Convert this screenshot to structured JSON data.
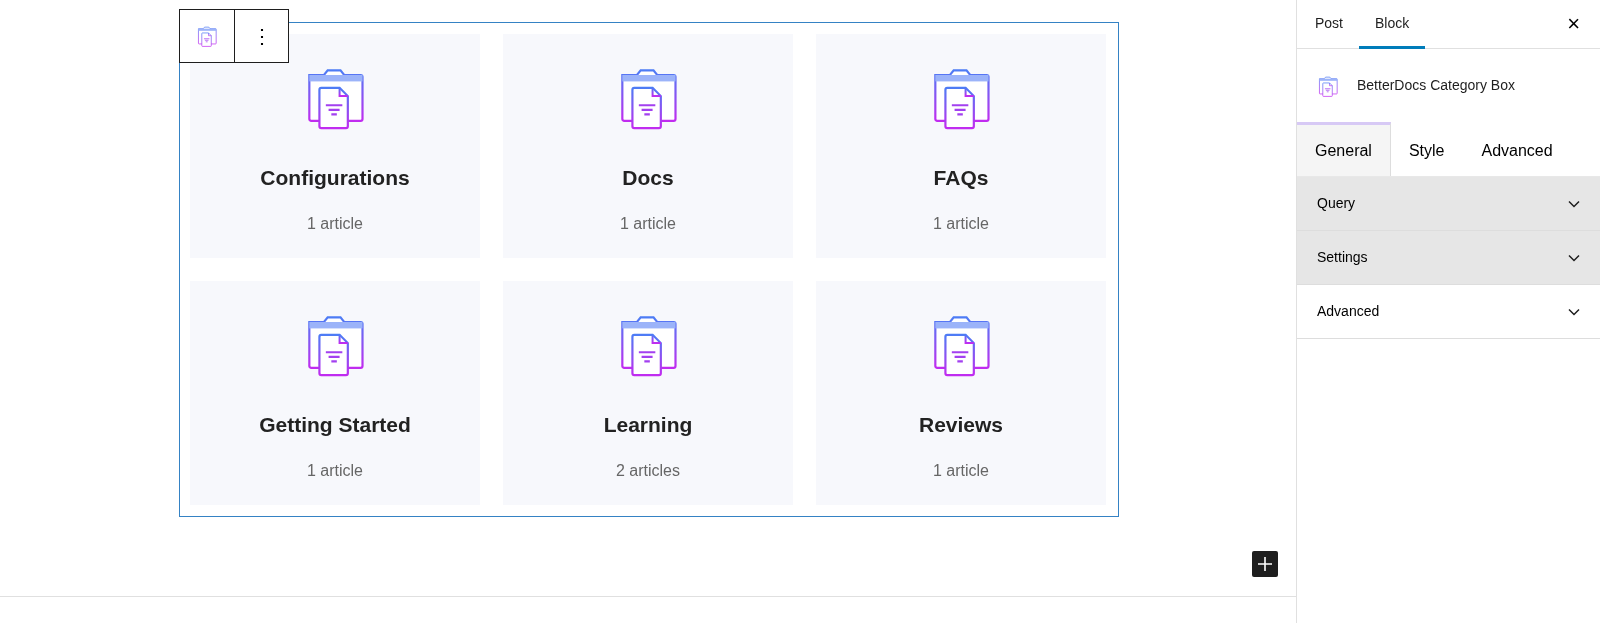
{
  "block_toolbar": {
    "more": "⋮"
  },
  "categories": [
    {
      "title": "Configurations",
      "count": "1 article"
    },
    {
      "title": "Docs",
      "count": "1 article"
    },
    {
      "title": "FAQs",
      "count": "1 article"
    },
    {
      "title": "Getting Started",
      "count": "1 article"
    },
    {
      "title": "Learning",
      "count": "2 articles"
    },
    {
      "title": "Reviews",
      "count": "1 article"
    }
  ],
  "sidebar": {
    "tabs": [
      {
        "label": "Post",
        "selected": false
      },
      {
        "label": "Block",
        "selected": true
      }
    ],
    "close": "×",
    "block_name": "BetterDocs Category Box",
    "inner_tabs": [
      {
        "label": "General",
        "selected": true
      },
      {
        "label": "Style",
        "selected": false
      },
      {
        "label": "Advanced",
        "selected": false
      }
    ],
    "panels": [
      {
        "label": "Query",
        "highlighted": true
      },
      {
        "label": "Settings",
        "highlighted": true
      },
      {
        "label": "Advanced",
        "highlighted": false
      }
    ]
  }
}
